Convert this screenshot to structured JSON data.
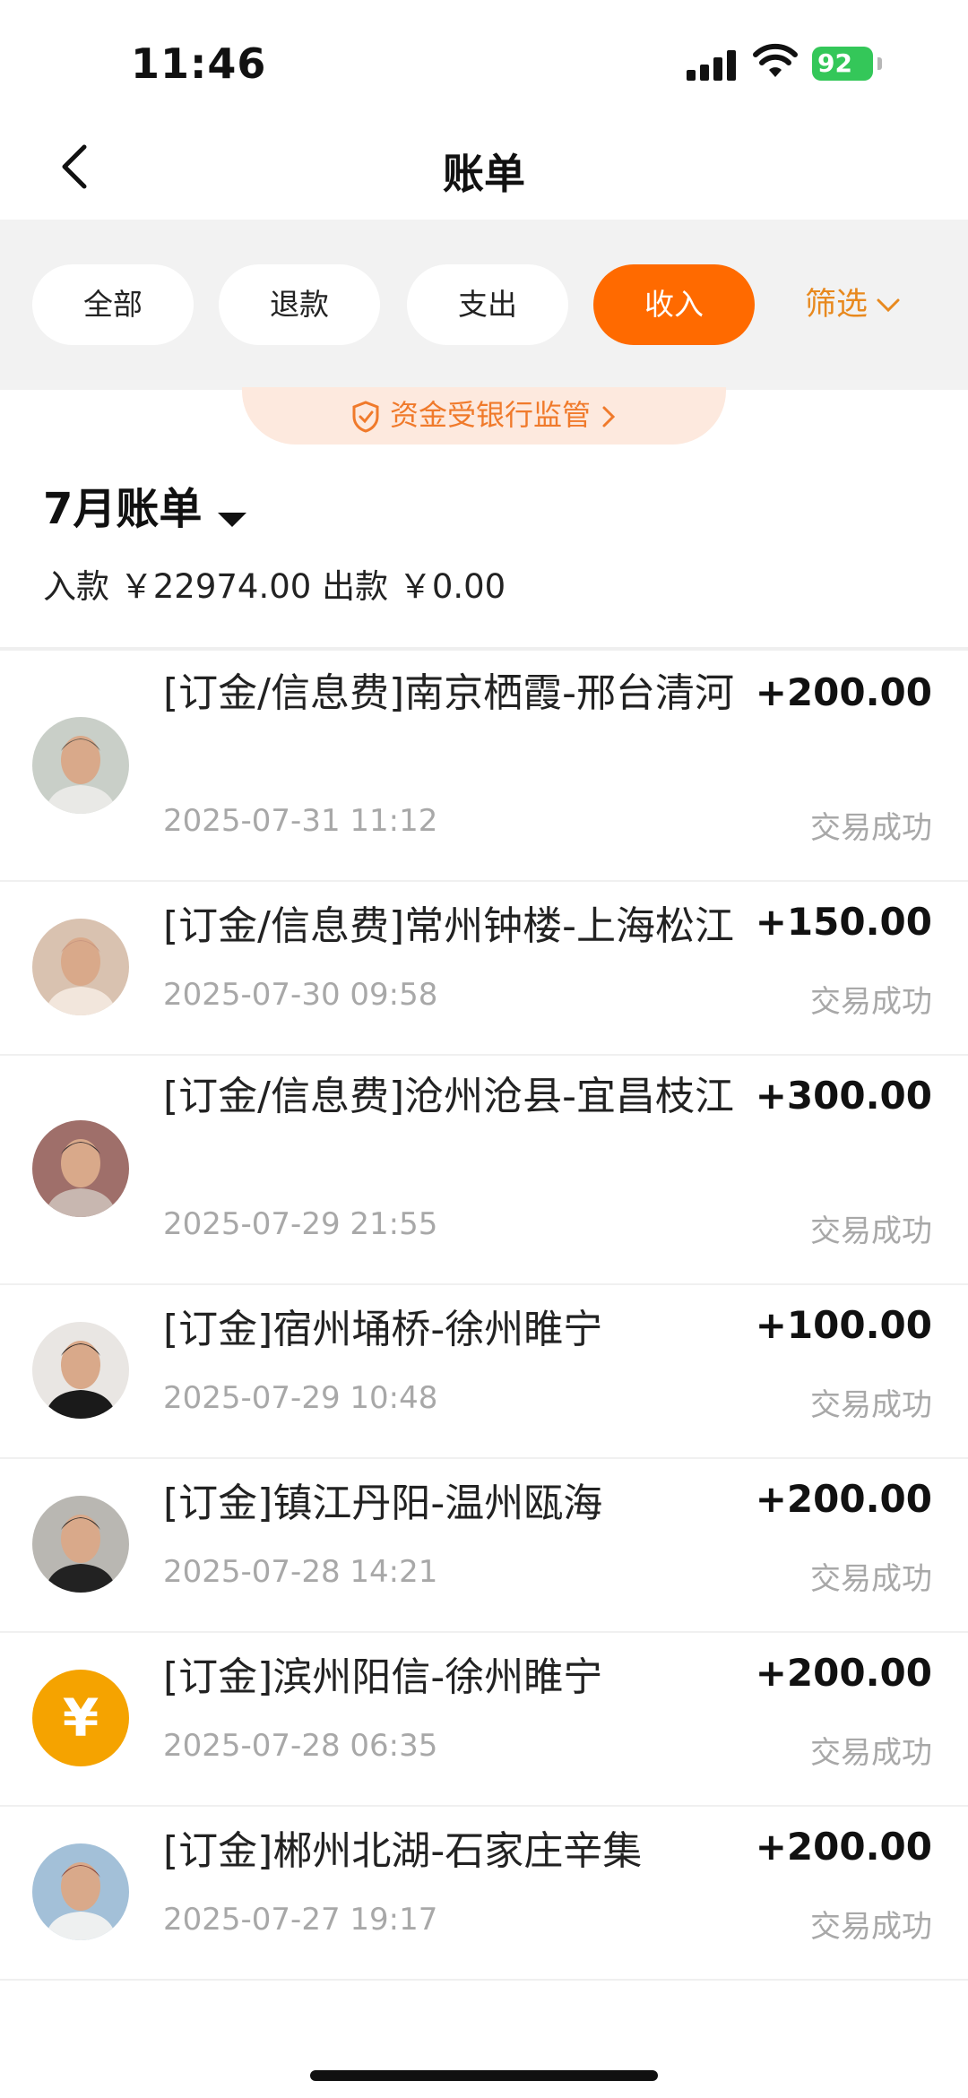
{
  "status": {
    "time": "11:46",
    "battery": "92"
  },
  "nav": {
    "title": "账单"
  },
  "filters": {
    "items": [
      "全部",
      "退款",
      "支出",
      "收入"
    ],
    "active": "收入",
    "filter_label": "筛选"
  },
  "banner": {
    "text": "资金受银行监管"
  },
  "summary": {
    "month": "7月账单",
    "totals": "入款 ￥22974.00 出款 ￥0.00"
  },
  "transactions": [
    {
      "title": "[订金/信息费]南京栖霞-邢台清河",
      "amount": "+200.00",
      "time": "2025-07-31 11:12",
      "status": "交易成功",
      "avatar": "photo"
    },
    {
      "title": "[订金/信息费]常州钟楼-上海松江",
      "amount": "+150.00",
      "time": "2025-07-30 09:58",
      "status": "交易成功",
      "avatar": "photo"
    },
    {
      "title": "[订金/信息费]沧州沧县-宜昌枝江",
      "amount": "+300.00",
      "time": "2025-07-29 21:55",
      "status": "交易成功",
      "avatar": "photo"
    },
    {
      "title": "[订金]宿州埇桥-徐州睢宁",
      "amount": "+100.00",
      "time": "2025-07-29 10:48",
      "status": "交易成功",
      "avatar": "photo"
    },
    {
      "title": "[订金]镇江丹阳-温州瓯海",
      "amount": "+200.00",
      "time": "2025-07-28 14:21",
      "status": "交易成功",
      "avatar": "photo"
    },
    {
      "title": "[订金]滨州阳信-徐州睢宁",
      "amount": "+200.00",
      "time": "2025-07-28 06:35",
      "status": "交易成功",
      "avatar": "yen",
      "avatar_glyph": "¥"
    },
    {
      "title": "[订金]郴州北湖-石家庄辛集",
      "amount": "+200.00",
      "time": "2025-07-27 19:17",
      "status": "交易成功",
      "avatar": "photo"
    }
  ],
  "colors": {
    "accent": "#ff6a00",
    "filter_text": "#e8891e",
    "yen_avatar": "#f5a300"
  }
}
